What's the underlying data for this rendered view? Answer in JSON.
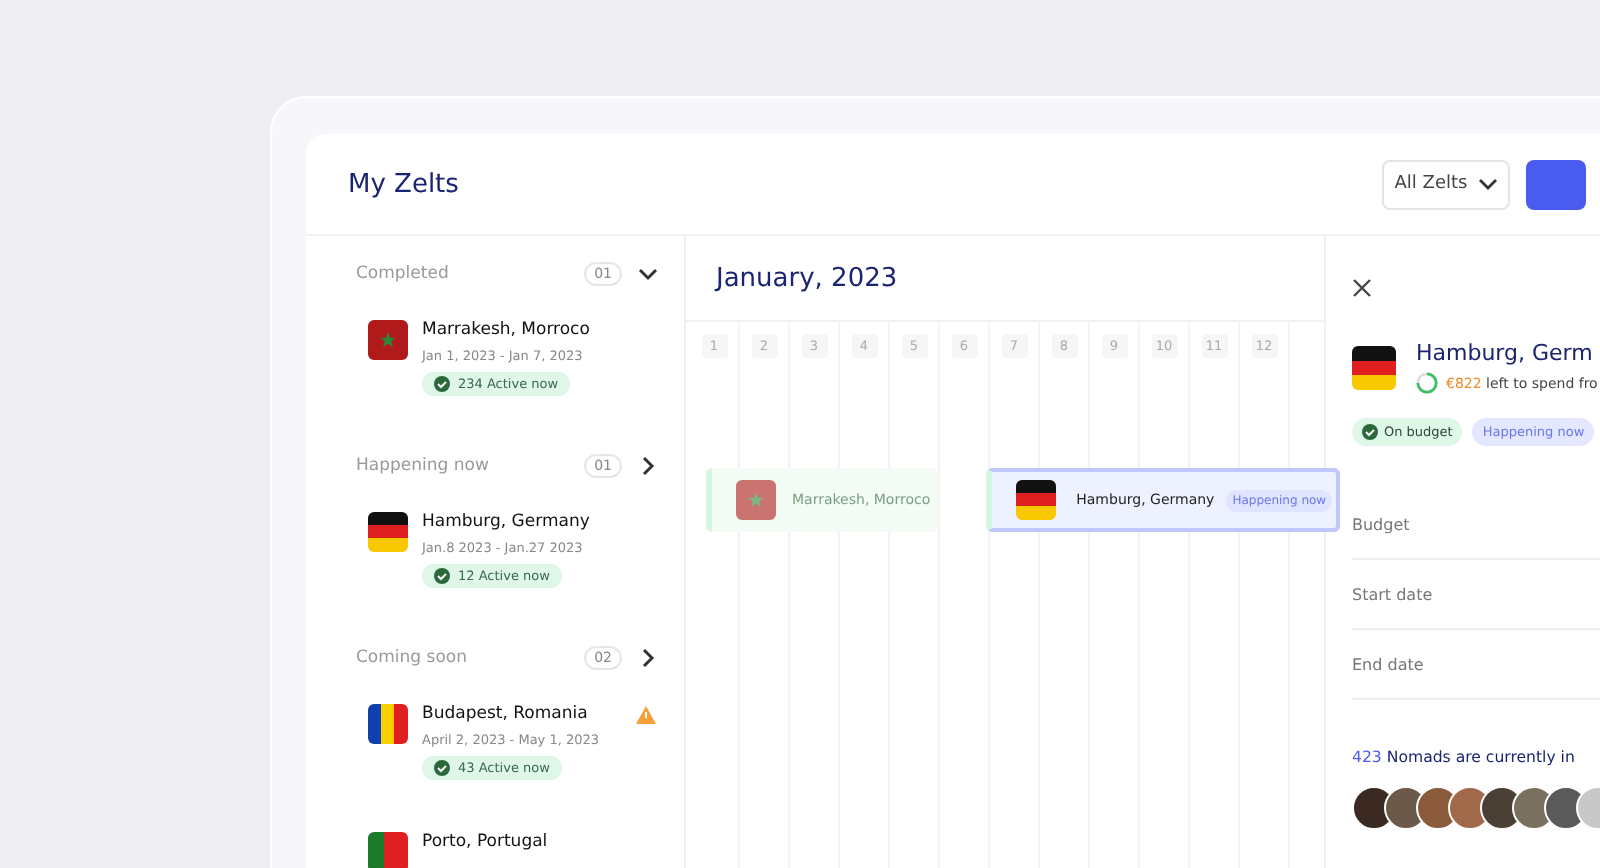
{
  "header": {
    "title": "My Zelts",
    "filter": "All Zelts"
  },
  "groups": [
    {
      "title": "Completed",
      "count": "01",
      "expanded": true,
      "items": [
        {
          "kind": "morocco",
          "name": "Marrakesh, Morroco",
          "dates": "Jan 1,  2023 - Jan 7,  2023",
          "active": "234 Active now",
          "warning": false
        }
      ]
    },
    {
      "title": "Happening now",
      "count": "01",
      "expanded": false,
      "items": [
        {
          "kind": "germany",
          "name": "Hamburg, Germany",
          "dates": "Jan.8  2023 - Jan.27  2023",
          "active": "12 Active now",
          "warning": false
        }
      ]
    },
    {
      "title": "Coming soon",
      "count": "02",
      "expanded": false,
      "items": [
        {
          "kind": "romania",
          "name": "Budapest, Romania",
          "dates": "April 2,  2023 - May 1,  2023",
          "active": "43 Active now",
          "warning": true
        },
        {
          "kind": "portugal",
          "name": "Porto, Portugal"
        }
      ]
    }
  ],
  "calendar": {
    "month": "January, 2023",
    "days": [
      "1",
      "2",
      "3",
      "4",
      "5",
      "6",
      "7",
      "8",
      "9",
      "10",
      "11",
      "12"
    ],
    "events": [
      {
        "kind": "morocco",
        "name": "Marrakesh, Morroco",
        "selected": false
      },
      {
        "kind": "germany",
        "name": "Hamburg, Germany",
        "tag": "Happening now",
        "selected": true
      }
    ]
  },
  "detail": {
    "kind": "germany",
    "title": "Hamburg, Germ",
    "amount": "€822",
    "spend": "left to spend fro",
    "tags": [
      {
        "kind": "budget",
        "label": "On budget"
      },
      {
        "kind": "status",
        "label": "Happening now"
      }
    ],
    "fields": [
      "Budget",
      "Start date",
      "End date"
    ],
    "count": "423",
    "nomads": "Nomads are currently in"
  }
}
